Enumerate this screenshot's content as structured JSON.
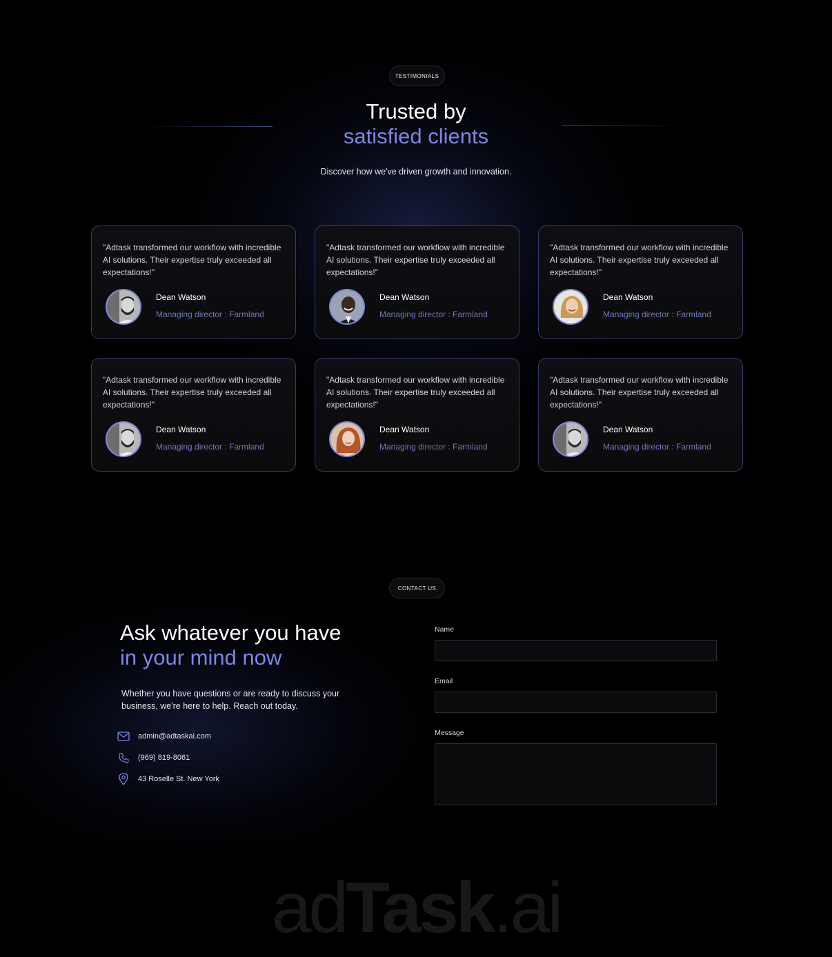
{
  "testimonials_section": {
    "badge": "TESTIMONIALS",
    "title_line1": "Trusted by",
    "title_line2": "satisfied clients",
    "subtitle": "Discover how we've driven growth and innovation.",
    "accent_color": "#7c86e3",
    "cards": [
      {
        "quote": "\"Adtask transformed our workflow with incredible AI solutions. Their expertise truly exceeded all expectations!\"",
        "name": "Dean Watson",
        "role": "Managing director : Farmland",
        "avatar": "avatar-man-beard-bw"
      },
      {
        "quote": "\"Adtask transformed our workflow with incredible AI solutions. Their expertise truly exceeded all expectations!\"",
        "name": "Dean Watson",
        "role": "Managing director : Farmland",
        "avatar": "avatar-man-smiling"
      },
      {
        "quote": "\"Adtask transformed our workflow with incredible AI solutions. Their expertise truly exceeded all expectations!\"",
        "name": "Dean Watson",
        "role": "Managing director : Farmland",
        "avatar": "avatar-woman-blonde"
      },
      {
        "quote": "\"Adtask transformed our workflow with incredible AI solutions. Their expertise truly exceeded all expectations!\"",
        "name": "Dean Watson",
        "role": "Managing director : Farmland",
        "avatar": "avatar-man-beard-bw"
      },
      {
        "quote": "\"Adtask transformed our workflow with incredible AI solutions. Their expertise truly exceeded all expectations!\"",
        "name": "Dean Watson",
        "role": "Managing director : Farmland",
        "avatar": "avatar-woman-redhead"
      },
      {
        "quote": "\"Adtask transformed our workflow with incredible AI solutions. Their expertise truly exceeded all expectations!\"",
        "name": "Dean Watson",
        "role": "Managing director : Farmland",
        "avatar": "avatar-man-beard-bw"
      }
    ]
  },
  "contact_section": {
    "badge": "CONTACT US",
    "title_line1": "Ask whatever you have",
    "title_line2": "in your mind now",
    "text": "Whether you have questions or are ready to discuss your business, we're here to help. Reach out today.",
    "email": "admin@adtaskai.com",
    "phone": "(969) 819-8061",
    "address": "43 Roselle St. New York",
    "form": {
      "name_label": "Name",
      "name_value": "",
      "email_label": "Email",
      "email_value": "",
      "message_label": "Message",
      "message_value": ""
    }
  },
  "brand": {
    "part1": "ad",
    "part2": "Task",
    "part3": ".ai"
  }
}
